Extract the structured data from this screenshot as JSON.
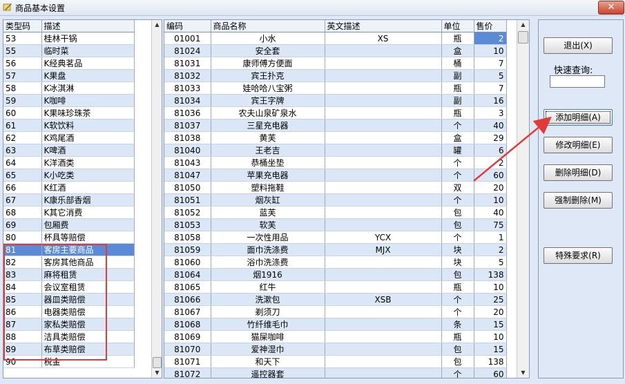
{
  "window": {
    "title": "商品基本设置",
    "close_symbol": "✕"
  },
  "category_grid": {
    "headers": [
      "类型码",
      "描述"
    ],
    "rows": [
      [
        "53",
        "桂林干锅"
      ],
      [
        "55",
        "临时菜"
      ],
      [
        "56",
        "K经典茗品"
      ],
      [
        "57",
        "K果盘"
      ],
      [
        "58",
        "K冰淇淋"
      ],
      [
        "59",
        "K咖啡"
      ],
      [
        "60",
        "K果味珍珠茶"
      ],
      [
        "61",
        "K软饮料"
      ],
      [
        "62",
        "K鸡尾酒"
      ],
      [
        "63",
        "K啤酒"
      ],
      [
        "64",
        "K洋酒类"
      ],
      [
        "65",
        "K小吃类"
      ],
      [
        "66",
        "K红酒"
      ],
      [
        "67",
        "K康乐部香烟"
      ],
      [
        "68",
        "K其它消费"
      ],
      [
        "69",
        "包厢费"
      ],
      [
        "80",
        "杯具等赔偿"
      ],
      [
        "81",
        "客房主要商品"
      ],
      [
        "82",
        "客房其他商品"
      ],
      [
        "83",
        "麻将租赁"
      ],
      [
        "84",
        "会议室租赁"
      ],
      [
        "85",
        "器皿类赔偿"
      ],
      [
        "86",
        "电器类赔偿"
      ],
      [
        "87",
        "家私类赔偿"
      ],
      [
        "88",
        "洁具类赔偿"
      ],
      [
        "89",
        "布草类赔偿"
      ],
      [
        "90",
        "税金"
      ]
    ],
    "selected_index": 17
  },
  "product_grid": {
    "headers": [
      "编码",
      "商品名称",
      "英文描述",
      "单位",
      "售价"
    ],
    "rows": [
      [
        "01001",
        "小水",
        "XS",
        "瓶",
        "2"
      ],
      [
        "81024",
        "安全套",
        "",
        "盒",
        "10"
      ],
      [
        "81031",
        "康师傅方便面",
        "",
        "桶",
        "7"
      ],
      [
        "81032",
        "宾王扑克",
        "",
        "副",
        "5"
      ],
      [
        "81033",
        "娃哈哈八宝粥",
        "",
        "瓶",
        "7"
      ],
      [
        "81034",
        "宾王字牌",
        "",
        "副",
        "16"
      ],
      [
        "81036",
        "农夫山泉矿泉水",
        "",
        "瓶",
        "3"
      ],
      [
        "81037",
        "三星充电器",
        "",
        "个",
        "40"
      ],
      [
        "81038",
        "黄芙",
        "",
        "盒",
        "29"
      ],
      [
        "81040",
        "王老吉",
        "",
        "罐",
        "6"
      ],
      [
        "81043",
        "恭桶坐垫",
        "",
        "个",
        "2"
      ],
      [
        "81047",
        "苹果充电器",
        "",
        "个",
        "60"
      ],
      [
        "81050",
        "塑料拖鞋",
        "",
        "双",
        "20"
      ],
      [
        "81051",
        "烟灰缸",
        "",
        "个",
        "10"
      ],
      [
        "81052",
        "蓝芙",
        "",
        "包",
        "40"
      ],
      [
        "81053",
        "软芙",
        "",
        "包",
        "75"
      ],
      [
        "81058",
        "一次性用品",
        "YCX",
        "个",
        "1"
      ],
      [
        "81059",
        "面巾洗涤费",
        "MJX",
        "块",
        "2"
      ],
      [
        "81060",
        "浴巾洗涤费",
        "",
        "块",
        "5"
      ],
      [
        "81064",
        "烟1916",
        "",
        "包",
        "138"
      ],
      [
        "81065",
        "红牛",
        "",
        "瓶",
        "10"
      ],
      [
        "81066",
        "洗漱包",
        "XSB",
        "个",
        "25"
      ],
      [
        "81067",
        "剃须刀",
        "",
        "个",
        "20"
      ],
      [
        "81068",
        "竹纤维毛巾",
        "",
        "条",
        "15"
      ],
      [
        "81069",
        "猫屎咖啡",
        "",
        "瓶",
        "10"
      ],
      [
        "81070",
        "爱神湿巾",
        "",
        "包",
        "15"
      ],
      [
        "81071",
        "和天下",
        "",
        "包",
        "138"
      ],
      [
        "81072",
        "遥控器套",
        "",
        "个",
        "60"
      ]
    ]
  },
  "side_panel": {
    "exit_label": "退出(X)",
    "quick_search_label": "快速查询:",
    "quick_search_value": "",
    "add_label": "添加明细(A)",
    "edit_label": "修改明细(E)",
    "delete_label": "删除明细(D)",
    "force_delete_label": "强制删除(M)",
    "special_label": "特殊要求(R)"
  },
  "annotation": {
    "highlight_color": "#e03a3a"
  }
}
